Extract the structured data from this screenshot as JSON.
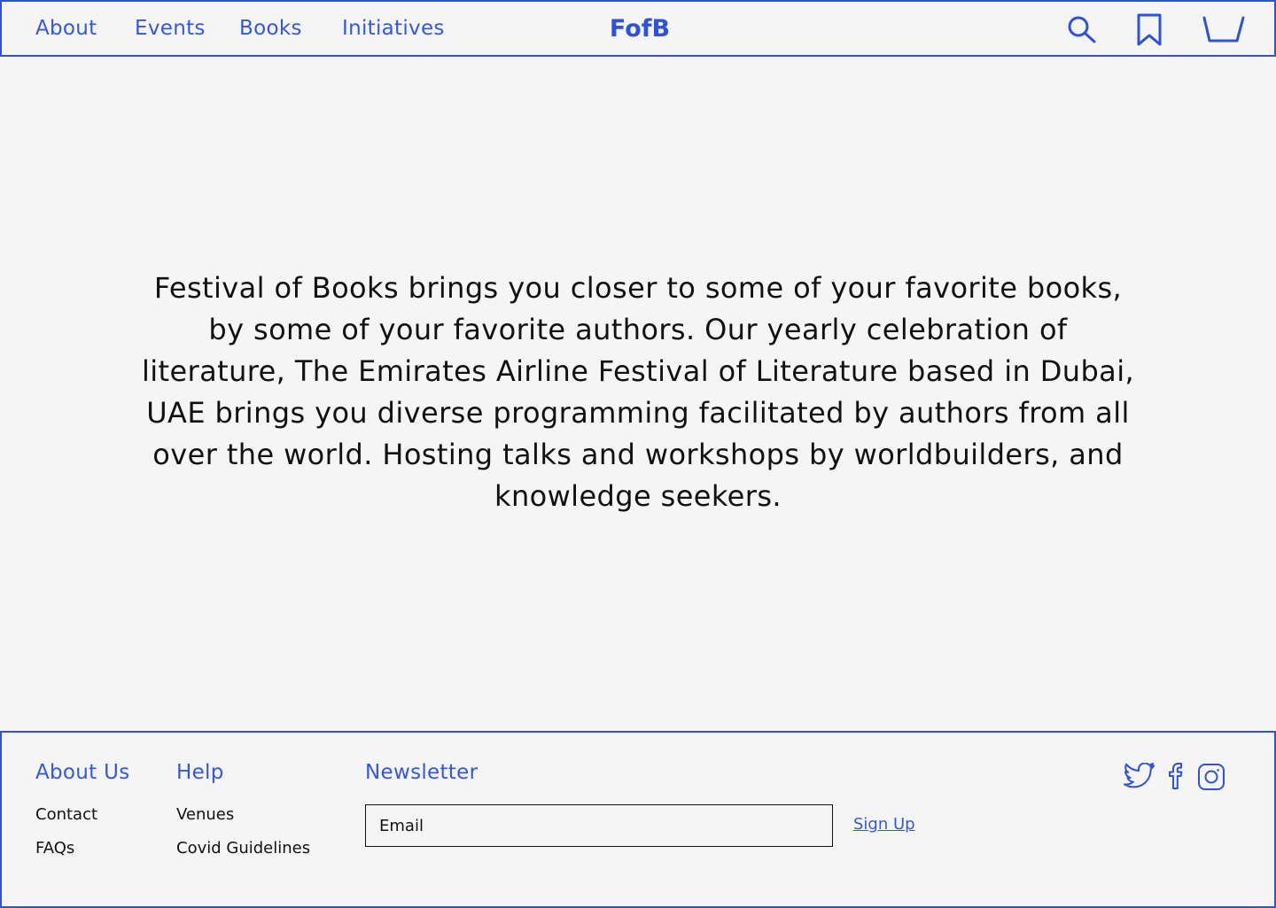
{
  "header": {
    "nav": [
      {
        "label": "About"
      },
      {
        "label": "Events"
      },
      {
        "label": "Books"
      },
      {
        "label": "Initiatives"
      }
    ],
    "logo": "FofB",
    "icons": [
      "search-icon",
      "bookmark-icon",
      "cart-icon"
    ]
  },
  "main": {
    "intro": "Festival of Books brings you closer to some of your favorite books, by some of your favorite authors. Our yearly celebration of literature, The Emirates Airline Festival of Literature based in Dubai, UAE brings you diverse programming facilitated by authors from all over the world. Hosting talks and workshops by worldbuilders, and knowledge seekers."
  },
  "footer": {
    "about": {
      "title": "About Us",
      "links": [
        "Contact",
        "FAQs"
      ]
    },
    "help": {
      "title": "Help",
      "links": [
        "Venues",
        "Covid Guidelines"
      ]
    },
    "newsletter": {
      "title": "Newsletter",
      "email_placeholder": "Email",
      "signup_label": "Sign Up"
    },
    "social_icons": [
      "twitter-icon",
      "facebook-icon",
      "instagram-icon"
    ]
  },
  "colors": {
    "accent": "#2e52d9",
    "background": "#f5f5f6",
    "text": "#111111"
  }
}
